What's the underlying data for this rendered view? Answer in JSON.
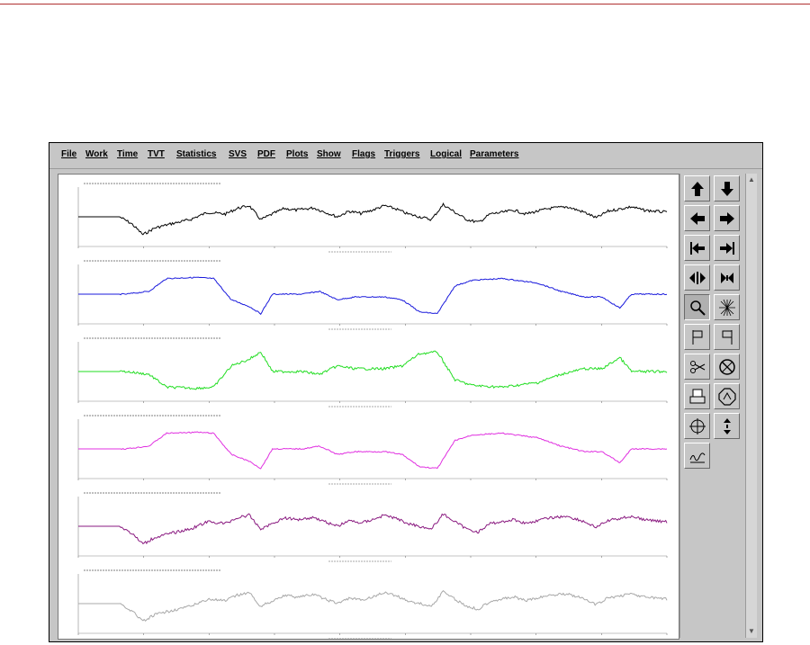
{
  "menu": {
    "items": [
      {
        "label": "File",
        "name": "menu-file"
      },
      {
        "label": "Work",
        "name": "menu-work"
      },
      {
        "label": "Time",
        "name": "menu-time"
      },
      {
        "label": "TVT",
        "name": "menu-tvt"
      },
      {
        "label": "Statistics",
        "name": "menu-statistics"
      },
      {
        "label": "SVS",
        "name": "menu-svs"
      },
      {
        "label": "PDF",
        "name": "menu-pdf"
      },
      {
        "label": "Plots",
        "name": "menu-plots"
      },
      {
        "label": "Show",
        "name": "menu-show"
      },
      {
        "label": "Flags",
        "name": "menu-flags"
      },
      {
        "label": "Triggers",
        "name": "menu-triggers"
      },
      {
        "label": "Logical",
        "name": "menu-logical"
      },
      {
        "label": "Parameters",
        "name": "menu-parameters"
      }
    ]
  },
  "plots": [
    {
      "color": "#000000",
      "name": "plot-black"
    },
    {
      "color": "#1a1adc",
      "name": "plot-blue"
    },
    {
      "color": "#22dd22",
      "name": "plot-green"
    },
    {
      "color": "#e030e0",
      "name": "plot-magenta"
    },
    {
      "color": "#8a1a80",
      "name": "plot-purple"
    },
    {
      "color": "#a8a8a8",
      "name": "plot-gray"
    }
  ],
  "toolbar": {
    "buttons": [
      {
        "icon": "arrow-up-icon",
        "name": "scroll-up-button"
      },
      {
        "icon": "arrow-down-icon",
        "name": "scroll-down-button"
      },
      {
        "icon": "arrow-left-icon",
        "name": "scroll-left-button"
      },
      {
        "icon": "arrow-right-icon",
        "name": "scroll-right-button"
      },
      {
        "icon": "go-start-icon",
        "name": "go-start-button"
      },
      {
        "icon": "go-end-icon",
        "name": "go-end-button"
      },
      {
        "icon": "expand-horizontal-icon",
        "name": "expand-button"
      },
      {
        "icon": "compress-horizontal-icon",
        "name": "compress-button"
      },
      {
        "icon": "magnifier-icon",
        "name": "zoom-button",
        "pressed": true
      },
      {
        "icon": "starburst-icon",
        "name": "starburst-button"
      },
      {
        "icon": "flag-left-icon",
        "name": "flag-left-button"
      },
      {
        "icon": "flag-right-icon",
        "name": "flag-right-button"
      },
      {
        "icon": "scissors-icon",
        "name": "cut-button"
      },
      {
        "icon": "no-cut-icon",
        "name": "no-cut-button"
      },
      {
        "icon": "printer-icon",
        "name": "print-button"
      },
      {
        "icon": "stop-sign-icon",
        "name": "stop-button"
      },
      {
        "icon": "crosshair-icon",
        "name": "crosshair-button"
      },
      {
        "icon": "vertical-resize-icon",
        "name": "vertical-resize-button"
      },
      {
        "icon": "signature-icon",
        "name": "signature-button"
      }
    ]
  }
}
